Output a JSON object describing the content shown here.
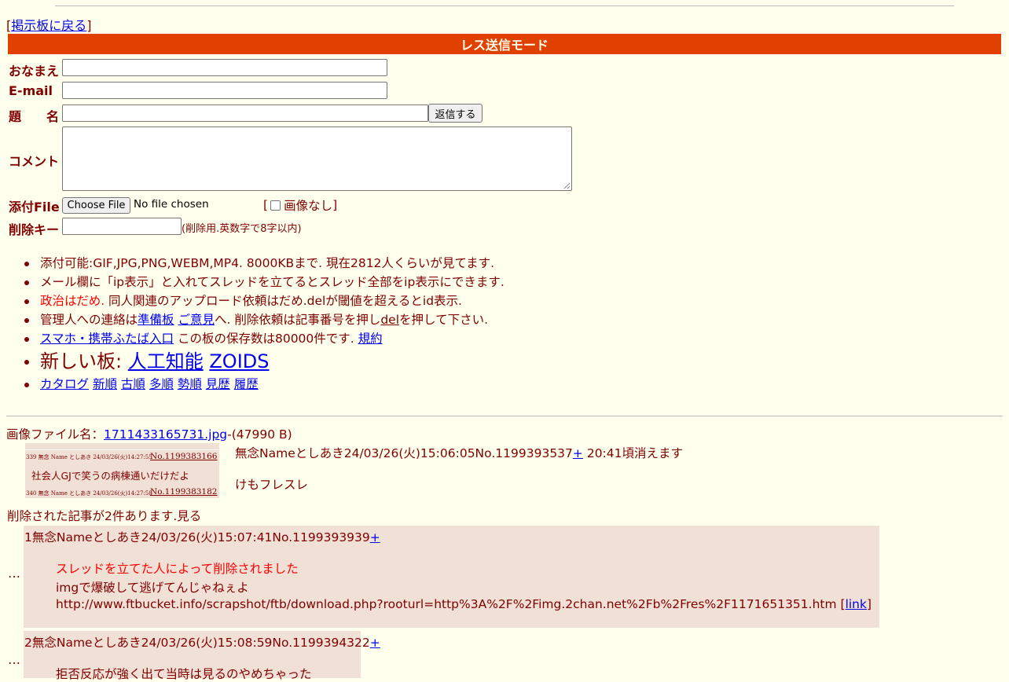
{
  "back": {
    "open": "[",
    "link": "掲示板に戻る",
    "close": "]"
  },
  "mode_title": "レス送信モード",
  "form": {
    "name_label": "おなまえ",
    "email_label": "E-mail",
    "subject_label": "題　　名",
    "submit_label": "返信する",
    "comment_label": "コメント",
    "file_label": "添付File",
    "choose_file": "Choose File",
    "no_file": "No file chosen",
    "noimage_open": "[",
    "noimage_label": "画像なし",
    "noimage_close": "]",
    "delkey_label": "削除キー",
    "delkey_note": "(削除用.英数字で8字以内)"
  },
  "notes": {
    "n1": "添付可能:GIF,JPG,PNG,WEBM,MP4. 8000KBまで. 現在2812人くらいが見てます.",
    "n2": "メール欄に「ip表示」と入れてスレッドを立てるとスレッド全部をip表示にできます.",
    "n3_red": "政治はだめ.",
    "n3_rest": " 同人関連のアップロード依頼はだめ.delが閾値を超えるとid表示.",
    "n4_a": "管理人への連絡は",
    "n4_link1": "準備板",
    "n4_link2": "ご意見",
    "n4_b": "へ. 削除依頼は記事番号を押し",
    "n4_del": "del",
    "n4_c": "を押して下さい.",
    "n5_link": "スマホ・携帯ふたば入口",
    "n5_text": " この板の保存数は80000件です. ",
    "n5_rules": "規約",
    "n6_text": "新しい板: ",
    "n6_link1": "人工知能",
    "n6_link2": "ZOIDS",
    "nav": [
      "カタログ",
      "新順",
      "古順",
      "多順",
      "勢順",
      "見歴",
      "履歴"
    ]
  },
  "thread": {
    "file_prefix": "画像ファイル名：",
    "file_name": "1711433165731.jpg",
    "file_size": "-(47990 B)",
    "thumb": {
      "row1_meta": "339 無念 Name としあき 24/03/26(火)14:27:55",
      "row1_no": "No.1199383166",
      "row1_text": "社会人GJで笑うの病棟通いだけだよ",
      "row2_meta": "340 無念 Name としあき 24/03/26(火)14:27:58",
      "row2_no": "No.1199383182"
    },
    "op_header": "無念Nameとしあき24/03/26(火)15:06:05No.1199393537",
    "op_plus": "+",
    "op_expire": " 20:41頃消えます",
    "op_body": "けもフレスレ",
    "deleted_note": "削除された記事が2件あります.見る"
  },
  "replies": [
    {
      "header": "1無念Nameとしあき24/03/26(火)15:07:41No.1199393939",
      "plus": "+",
      "deleted_msg": "スレッドを立てた人によって削除されました",
      "line1": "imgで爆破して逃げてんじゃねぇよ",
      "url": "http://www.ftbucket.info/scrapshot/ftb/download.php?rooturl=http%3A%2F%2Fimg.2chan.net%2Fb%2Fres%2F1171651351.htm",
      "link_open": " [",
      "link_label": "link",
      "link_close": "]"
    },
    {
      "header": "2無念Nameとしあき24/03/26(火)15:08:59No.1199394322",
      "plus": "+",
      "line1": "拒否反応が強く出て当時は見るのやめちゃった"
    }
  ],
  "dots": "…"
}
